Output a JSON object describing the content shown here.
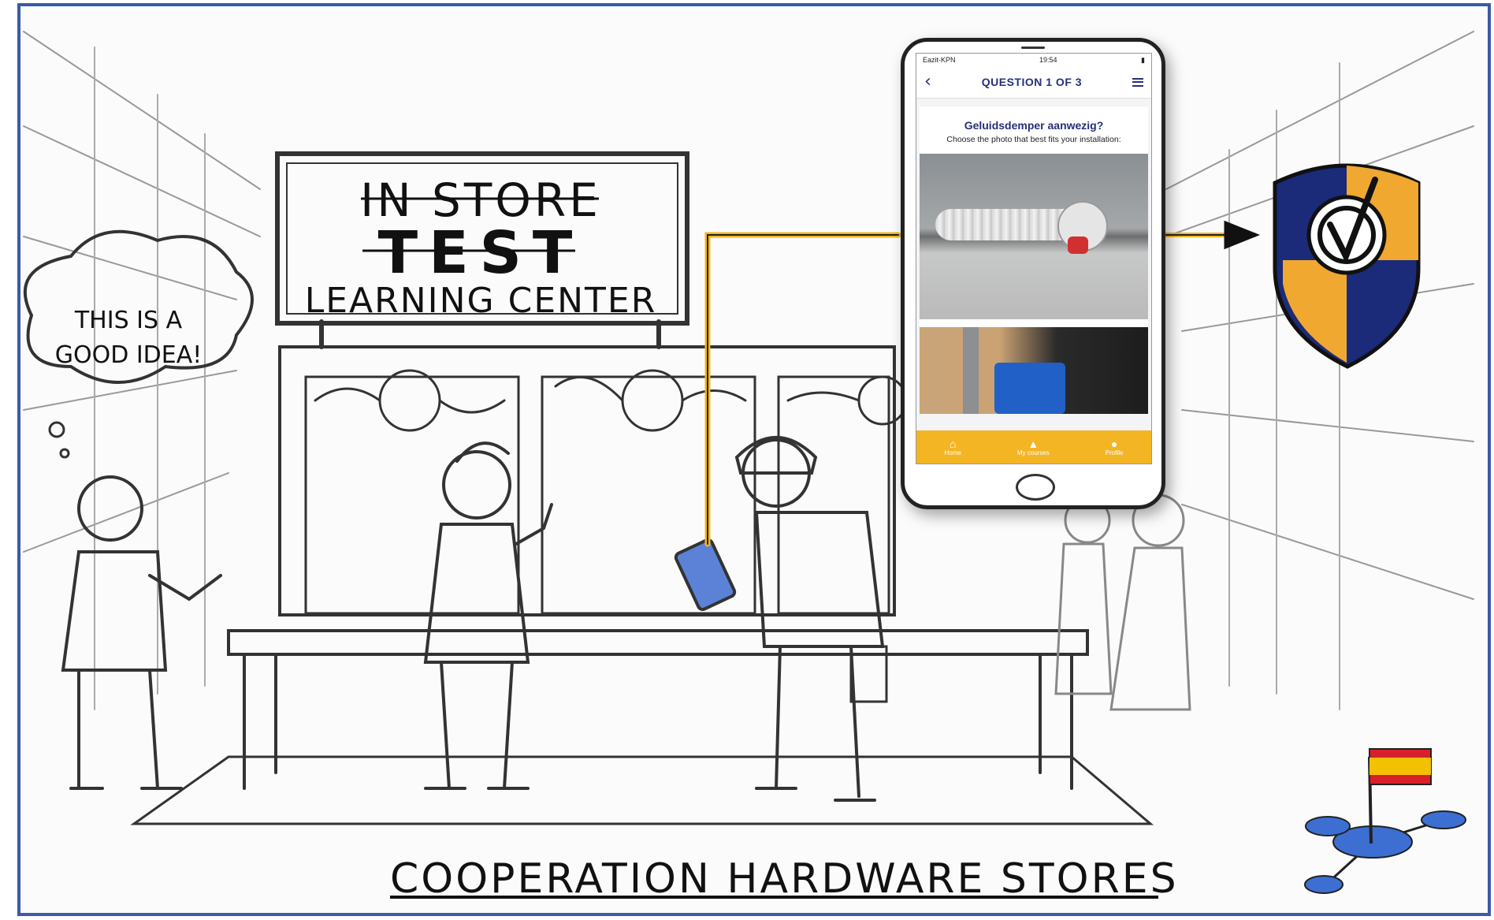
{
  "sign": {
    "line1": "IN STORE",
    "line2": "TEST",
    "line3": "LEARNING CENTER"
  },
  "speech_bubble": {
    "line1": "THIS IS A",
    "line2": "GOOD IDEA!"
  },
  "caption": "COOPERATION  HARDWARE STORES",
  "phone": {
    "carrier": "Eazit-KPN",
    "time": "19:54",
    "header_title": "QUESTION 1 OF 3",
    "question": "Geluidsdemper aanwezig?",
    "instruction": "Choose the photo that best fits your installation:",
    "tabs": [
      {
        "label": "Home",
        "icon": "home-icon"
      },
      {
        "label": "My courses",
        "icon": "graduation-cap-icon"
      },
      {
        "label": "Profile",
        "icon": "user-icon"
      }
    ]
  },
  "colors": {
    "frame": "#3b5aa8",
    "accent_yellow": "#f3b523",
    "brand_navy": "#262f7a",
    "flag_red": "#d8202a",
    "flag_yellow": "#f2c200",
    "network_blue": "#3c6fd1"
  }
}
